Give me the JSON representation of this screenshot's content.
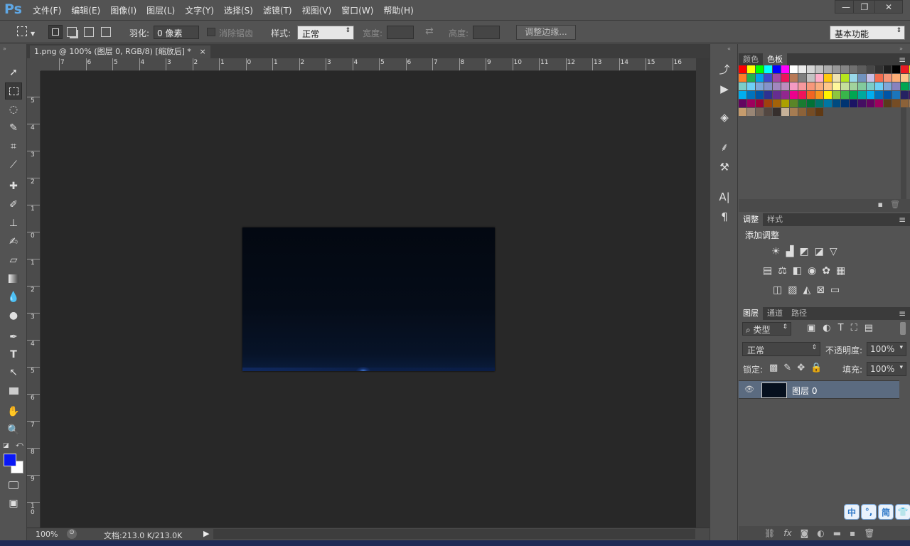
{
  "app": {
    "logo": "Ps"
  },
  "menu": [
    "文件(F)",
    "编辑(E)",
    "图像(I)",
    "图层(L)",
    "文字(Y)",
    "选择(S)",
    "滤镜(T)",
    "视图(V)",
    "窗口(W)",
    "帮助(H)"
  ],
  "window_buttons": {
    "minimize": "—",
    "restore": "❐",
    "close": "✕"
  },
  "options": {
    "feather_label": "羽化:",
    "feather_value": "0 像素",
    "antialias_label": "消除锯齿",
    "style_label": "样式:",
    "style_value": "正常",
    "width_label": "宽度:",
    "height_label": "高度:",
    "refine_edge": "调整边缘...",
    "workspace": "基本功能"
  },
  "document": {
    "tab_title": "1.png @ 100% (图层 0, RGB/8) [缩放后] *",
    "close": "×",
    "zoom": "100%",
    "doc_info": "文档:213.0 K/213.0K"
  },
  "rulers": {
    "h_ticks": [
      "7",
      "6",
      "5",
      "4",
      "3",
      "2",
      "1",
      "0",
      "1",
      "2",
      "3",
      "4",
      "5",
      "6",
      "7",
      "8",
      "9",
      "10",
      "11",
      "12",
      "13",
      "14",
      "15",
      "16"
    ],
    "v_ticks": [
      "5",
      "4",
      "3",
      "2",
      "1",
      "0",
      "1",
      "2",
      "3",
      "4",
      "5",
      "6",
      "7",
      "8",
      "9",
      "1 0"
    ]
  },
  "colors": {
    "foreground": "#0a18f5",
    "background": "#ffffff",
    "swatches": [
      "#ff0000",
      "#ffff00",
      "#00ff00",
      "#00ffff",
      "#0000ff",
      "#ff00ff",
      "#ffffff",
      "#ebebeb",
      "#d6d6d6",
      "#c2c2c2",
      "#adadad",
      "#999999",
      "#858585",
      "#707070",
      "#5c5c5c",
      "#474747",
      "#333333",
      "#1f1f1f",
      "#000000",
      "#ed1c24",
      "#fff200",
      "#ff7f27",
      "#22b14c",
      "#00a2e8",
      "#3f48cc",
      "#a349a4",
      "#ed145b",
      "#b97a57",
      "#7f7f7f",
      "#c3c3c3",
      "#ffaec9",
      "#ffc90e",
      "#efe4b0",
      "#b5e61d",
      "#99d9ea",
      "#7092be",
      "#c8bfe7",
      "#f26c4f",
      "#f69679",
      "#fbad76",
      "#fdc689",
      "#8fd3a3",
      "#7bcdc8",
      "#6dcff6",
      "#7da7d9",
      "#8493ca",
      "#a187be",
      "#bc8dbf",
      "#f49ac2",
      "#f6989d",
      "#f7977a",
      "#f9ad81",
      "#fdc68a",
      "#fff79a",
      "#c4df9b",
      "#a2d39c",
      "#82ca9d",
      "#7accc8",
      "#6ecff6",
      "#7ea7d8",
      "#8882be",
      "#00a651",
      "#00a99d",
      "#00aeef",
      "#0072bc",
      "#0054a6",
      "#2e3192",
      "#662d91",
      "#92278f",
      "#ec008c",
      "#ed145b",
      "#f26522",
      "#f7941d",
      "#fff200",
      "#8dc63f",
      "#39b54a",
      "#00a651",
      "#00a99d",
      "#00aeef",
      "#0072bc",
      "#0054a6",
      "#1b75bb",
      "#262262",
      "#440e62",
      "#630460",
      "#9e005d",
      "#9e0039",
      "#a0410d",
      "#a36209",
      "#aba000",
      "#598527",
      "#197b30",
      "#007236",
      "#00746b",
      "#0076a3",
      "#004a80",
      "#003471",
      "#1b1464",
      "#440e62",
      "#630460",
      "#9e005d",
      "#5a3a1a",
      "#754c24",
      "#8c6239",
      "#a67c52",
      "#c69c6d",
      "#998675",
      "#736357",
      "#534741",
      "#362f2d",
      "#c7b299",
      "#a67c52",
      "#8c6239",
      "#754c24",
      "#603913"
    ]
  },
  "panels": {
    "top_tabs": [
      "颜色",
      "色板"
    ],
    "adjust_tabs": [
      "调整",
      "样式"
    ],
    "adjust_title": "添加调整",
    "layer_tabs": [
      "图层",
      "通道",
      "路径"
    ],
    "kind_filter": "类型",
    "blend_mode": "正常",
    "opacity_label": "不透明度:",
    "opacity_value": "100%",
    "lock_label": "锁定:",
    "fill_label": "填充:",
    "fill_value": "100%",
    "layers": [
      {
        "name": "图层 0"
      }
    ]
  },
  "ime": [
    "中",
    "°,",
    "简",
    "👕"
  ]
}
